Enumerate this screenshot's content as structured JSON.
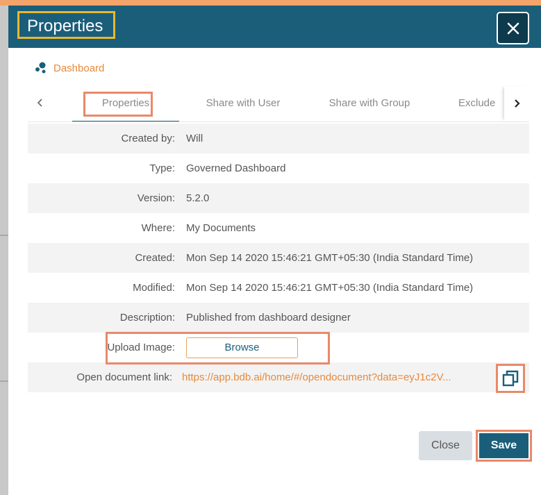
{
  "dialog": {
    "title": "Properties",
    "close_icon": "close-icon"
  },
  "breadcrumb": {
    "icon": "dashboard-icon",
    "label": "Dashboard"
  },
  "tabs": [
    {
      "label": "Properties",
      "active": true
    },
    {
      "label": "Share with User",
      "active": false
    },
    {
      "label": "Share with Group",
      "active": false
    },
    {
      "label": "Exclude",
      "active": false
    }
  ],
  "properties": {
    "created_by": {
      "label": "Created by:",
      "value": "Will"
    },
    "type": {
      "label": "Type:",
      "value": "Governed Dashboard"
    },
    "version": {
      "label": "Version:",
      "value": "5.2.0"
    },
    "where": {
      "label": "Where:",
      "value": "My Documents"
    },
    "created": {
      "label": "Created:",
      "value": "Mon Sep 14 2020 15:46:21 GMT+05:30 (India Standard Time)"
    },
    "modified": {
      "label": "Modified:",
      "value": "Mon Sep 14 2020 15:46:21 GMT+05:30 (India Standard Time)"
    },
    "description": {
      "label": "Description:",
      "value": "Published from dashboard designer"
    },
    "upload_image": {
      "label": "Upload Image:",
      "button": "Browse"
    },
    "open_link": {
      "label": "Open document link:",
      "value": "https://app.bdb.ai/home/#/opendocument?data=eyJ1c2V..."
    }
  },
  "footer": {
    "close_label": "Close",
    "save_label": "Save"
  },
  "colors": {
    "header": "#1b5e7a",
    "accent": "#e8893a",
    "highlight": "#e8896a",
    "title_highlight": "#e8b830"
  }
}
